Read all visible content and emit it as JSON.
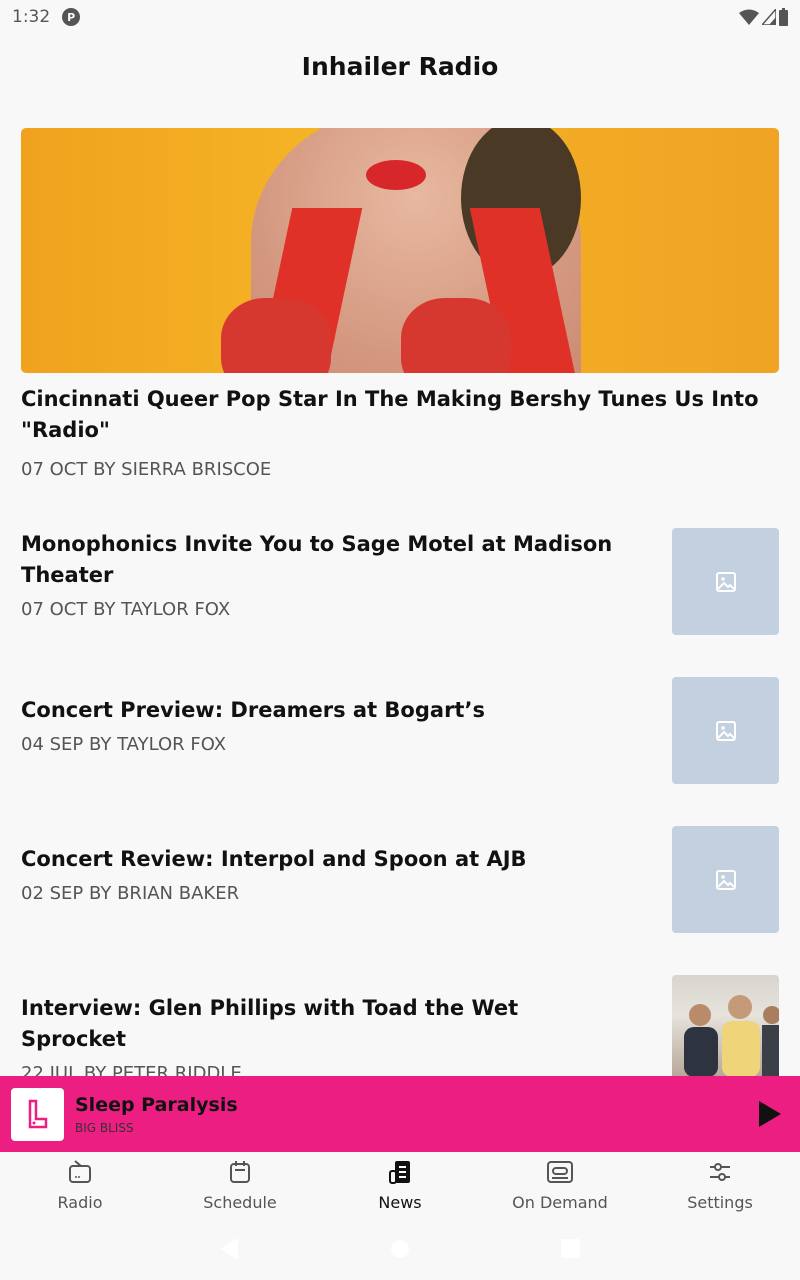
{
  "status": {
    "time": "1:32"
  },
  "header": {
    "title": "Inhailer Radio"
  },
  "featured": {
    "title": "Cincinnati Queer Pop Star In The Making Bershy Tunes Us Into \"Radio\"",
    "meta": "07 OCT BY SIERRA BRISCOE"
  },
  "articles": [
    {
      "title": "Monophonics Invite You to Sage Motel at Madison Theater",
      "meta": "07 OCT BY TAYLOR FOX",
      "thumb": "placeholder"
    },
    {
      "title": "Concert Preview: Dreamers at Bogart’s",
      "meta": "04 SEP BY TAYLOR FOX",
      "thumb": "placeholder"
    },
    {
      "title": "Concert Review: Interpol and Spoon at AJB",
      "meta": "02 SEP BY BRIAN BAKER",
      "thumb": "placeholder"
    },
    {
      "title": "Interview: Glen Phillips with Toad the Wet Sprocket",
      "meta": "22 JUL BY PETER RIDDLE",
      "thumb": "photo"
    }
  ],
  "player": {
    "song": "Sleep Paralysis",
    "artist": "BIG BLISS",
    "color": "#ec1e82"
  },
  "nav": {
    "items": [
      {
        "label": "Radio",
        "icon": "radio-icon"
      },
      {
        "label": "Schedule",
        "icon": "calendar-icon"
      },
      {
        "label": "News",
        "icon": "newspaper-icon",
        "active": true
      },
      {
        "label": "On Demand",
        "icon": "cassette-icon"
      },
      {
        "label": "Settings",
        "icon": "sliders-icon"
      }
    ]
  }
}
